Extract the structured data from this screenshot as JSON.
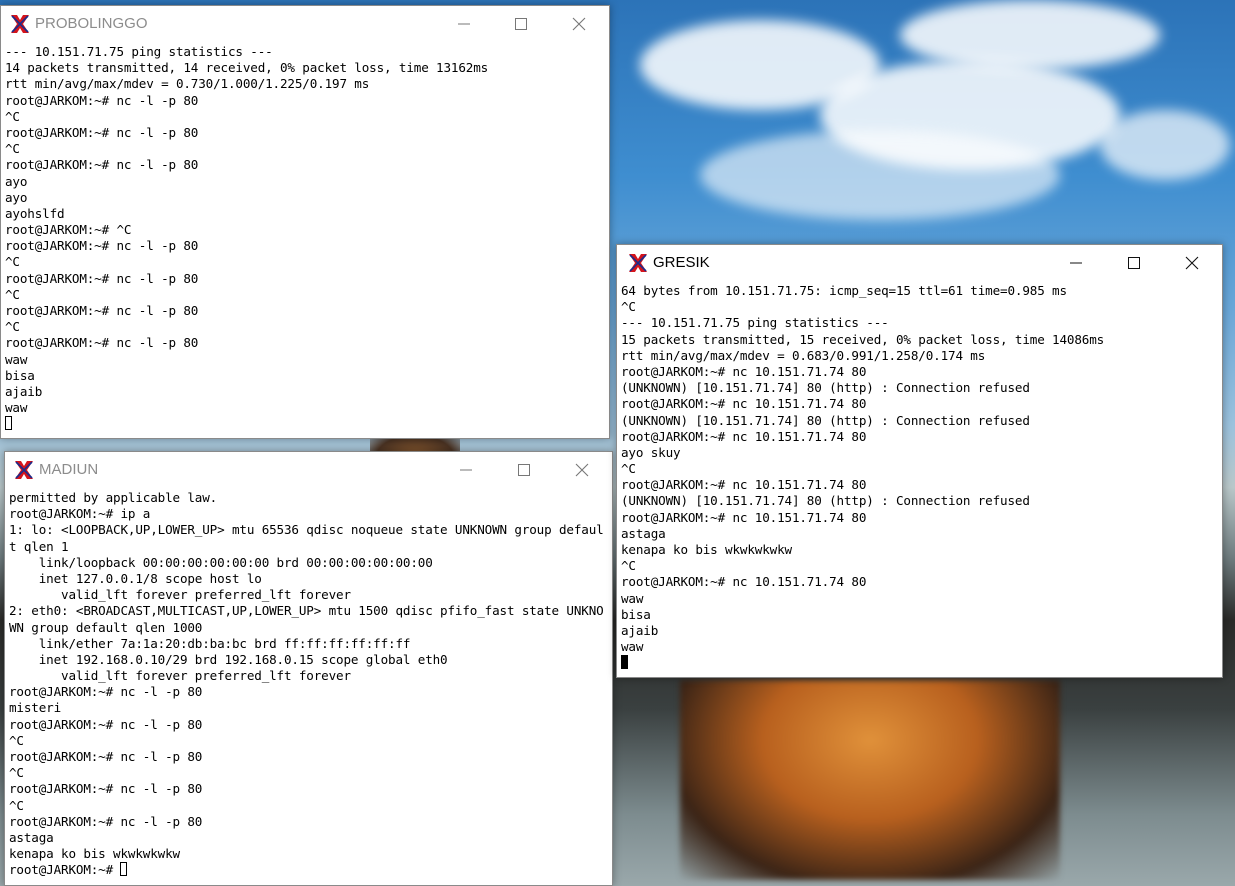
{
  "windows": {
    "probolinggo": {
      "title": "PROBOLINGGO",
      "icon": "xterm-icon",
      "lines": [
        "--- 10.151.71.75 ping statistics ---",
        "14 packets transmitted, 14 received, 0% packet loss, time 13162ms",
        "rtt min/avg/max/mdev = 0.730/1.000/1.225/0.197 ms",
        "root@JARKOM:~# nc -l -p 80",
        "^C",
        "root@JARKOM:~# nc -l -p 80",
        "^C",
        "root@JARKOM:~# nc -l -p 80",
        "ayo",
        "ayo",
        "ayohslfd",
        "root@JARKOM:~# ^C",
        "root@JARKOM:~# nc -l -p 80",
        "^C",
        "root@JARKOM:~# nc -l -p 80",
        "^C",
        "root@JARKOM:~# nc -l -p 80",
        "^C",
        "root@JARKOM:~# nc -l -p 80",
        "waw",
        "bisa",
        "ajaib",
        "waw",
        ""
      ]
    },
    "madiun": {
      "title": "MADIUN",
      "icon": "xterm-icon",
      "lines": [
        "permitted by applicable law.",
        "root@JARKOM:~# ip a",
        "1: lo: <LOOPBACK,UP,LOWER_UP> mtu 65536 qdisc noqueue state UNKNOWN group defaul",
        "t qlen 1",
        "    link/loopback 00:00:00:00:00:00 brd 00:00:00:00:00:00",
        "    inet 127.0.0.1/8 scope host lo",
        "       valid_lft forever preferred_lft forever",
        "2: eth0: <BROADCAST,MULTICAST,UP,LOWER_UP> mtu 1500 qdisc pfifo_fast state UNKNO",
        "WN group default qlen 1000",
        "    link/ether 7a:1a:20:db:ba:bc brd ff:ff:ff:ff:ff:ff",
        "    inet 192.168.0.10/29 brd 192.168.0.15 scope global eth0",
        "       valid_lft forever preferred_lft forever",
        "root@JARKOM:~# nc -l -p 80",
        "misteri",
        "root@JARKOM:~# nc -l -p 80",
        "^C",
        "root@JARKOM:~# nc -l -p 80",
        "^C",
        "root@JARKOM:~# nc -l -p 80",
        "^C",
        "root@JARKOM:~# nc -l -p 80",
        "astaga",
        "kenapa ko bis wkwkwkwkw",
        "root@JARKOM:~# "
      ]
    },
    "gresik": {
      "title": "GRESIK",
      "icon": "xterm-icon",
      "lines": [
        "64 bytes from 10.151.71.75: icmp_seq=15 ttl=61 time=0.985 ms",
        "^C",
        "--- 10.151.71.75 ping statistics ---",
        "15 packets transmitted, 15 received, 0% packet loss, time 14086ms",
        "rtt min/avg/max/mdev = 0.683/0.991/1.258/0.174 ms",
        "root@JARKOM:~# nc 10.151.71.74 80",
        "(UNKNOWN) [10.151.71.74] 80 (http) : Connection refused",
        "root@JARKOM:~# nc 10.151.71.74 80",
        "(UNKNOWN) [10.151.71.74] 80 (http) : Connection refused",
        "root@JARKOM:~# nc 10.151.71.74 80",
        "ayo skuy",
        "^C",
        "root@JARKOM:~# nc 10.151.71.74 80",
        "(UNKNOWN) [10.151.71.74] 80 (http) : Connection refused",
        "root@JARKOM:~# nc 10.151.71.74 80",
        "astaga",
        "kenapa ko bis wkwkwkwkw",
        "^C",
        "root@JARKOM:~# nc 10.151.71.74 80",
        "waw",
        "bisa",
        "ajaib",
        "waw",
        ""
      ]
    }
  },
  "colors": {
    "icon_red": "#d4141c",
    "icon_blue": "#1a2c8c",
    "inactive_title": "#8c8c8c"
  }
}
